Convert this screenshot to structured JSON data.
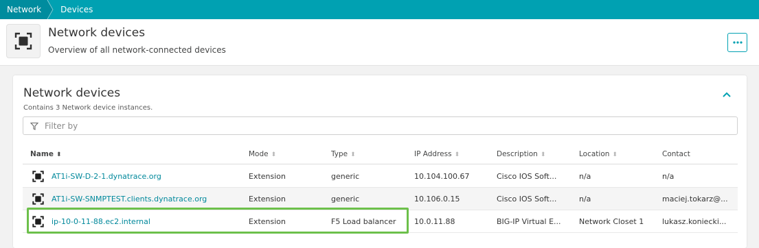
{
  "breadcrumb": {
    "root": "Network",
    "current": "Devices"
  },
  "header": {
    "title": "Network devices",
    "subtitle": "Overview of all network-connected devices",
    "icon": "network-device-icon",
    "more_icon": "more-icon"
  },
  "card": {
    "title": "Network devices",
    "count_text": "Contains 3 Network device instances.",
    "collapse_icon": "chevron-up-icon"
  },
  "filter": {
    "placeholder": "Filter by",
    "value": ""
  },
  "table": {
    "columns": [
      "Name",
      "Mode",
      "Type",
      "IP Address",
      "Description",
      "Location",
      "Contact"
    ],
    "sorted_column": "Name",
    "rows": [
      {
        "name": "AT1i-SW-D-2-1.dynatrace.org",
        "mode": "Extension",
        "type": "generic",
        "ip": "10.104.100.67",
        "description": "Cisco IOS Soft...",
        "location": "n/a",
        "contact": "n/a"
      },
      {
        "name": "AT1i-SW-SNMPTEST.clients.dynatrace.org",
        "mode": "Extension",
        "type": "generic",
        "ip": "10.106.0.15",
        "description": "Cisco IOS Soft...",
        "location": "n/a",
        "contact": "maciej.tokarz@..."
      },
      {
        "name": "ip-10-0-11-88.ec2.internal",
        "mode": "Extension",
        "type": "F5 Load balancer",
        "ip": "10.0.11.88",
        "description": "BIG-IP Virtual E...",
        "location": "Network Closet 1",
        "contact": "lukasz.koniecki..."
      }
    ]
  },
  "colors": {
    "accent": "#00a1b2",
    "link": "#00889b",
    "highlight": "#6cc04a"
  }
}
